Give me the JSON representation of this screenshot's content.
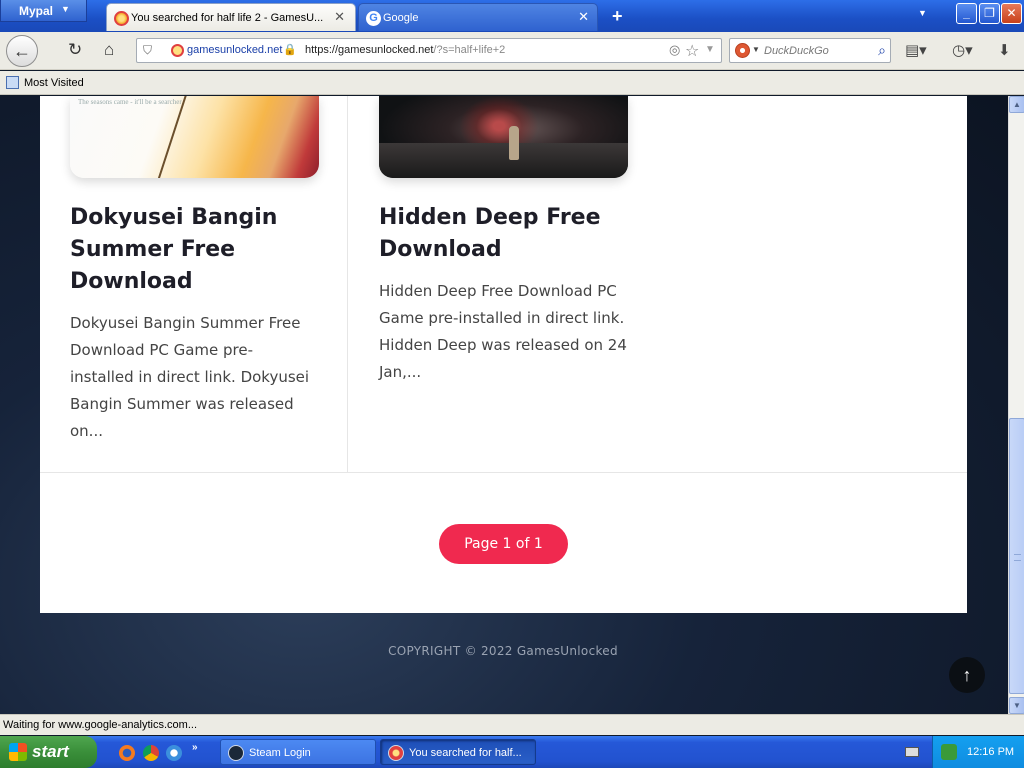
{
  "browser": {
    "menu_button": "Mypal",
    "tabs": [
      {
        "label": "You searched for half life 2 - GamesU...",
        "active": true
      },
      {
        "label": "Google",
        "active": false
      }
    ],
    "new_tab": "+",
    "url_site": "gamesunlocked.net",
    "url_origin": "https://gamesunlocked.net",
    "url_path": "/?s=half+life+2",
    "search_engine": "DuckDuckGo",
    "bookmarks": [
      {
        "label": "Most Visited"
      }
    ],
    "status": "Waiting for www.google-analytics.com..."
  },
  "page": {
    "posts": [
      {
        "title": "Dokyusei Bangin Summer Free Download",
        "excerpt": "Dokyusei Bangin Summer Free Download PC Game pre-installed in direct link. Dokyusei Bangin Summer was released on...",
        "thumb_caption": "The seasons came - it'll be a searcher"
      },
      {
        "title": "Hidden Deep Free Download",
        "excerpt": "Hidden Deep Free Download PC Game pre-installed in direct link. Hidden Deep was released on 24 Jan,..."
      }
    ],
    "pagination": "Page 1 of 1",
    "copyright": "COPYRIGHT © 2022 GamesUnlocked",
    "back_to_top": "↑"
  },
  "taskbar": {
    "start_label": "start",
    "tasks": [
      {
        "label": "Steam Login"
      },
      {
        "label": "You searched for half..."
      }
    ],
    "clock": "12:16 PM"
  },
  "colors": {
    "accent": "#f0294f",
    "xp_blue": "#2558d8",
    "start_green": "#3a8f3a"
  }
}
